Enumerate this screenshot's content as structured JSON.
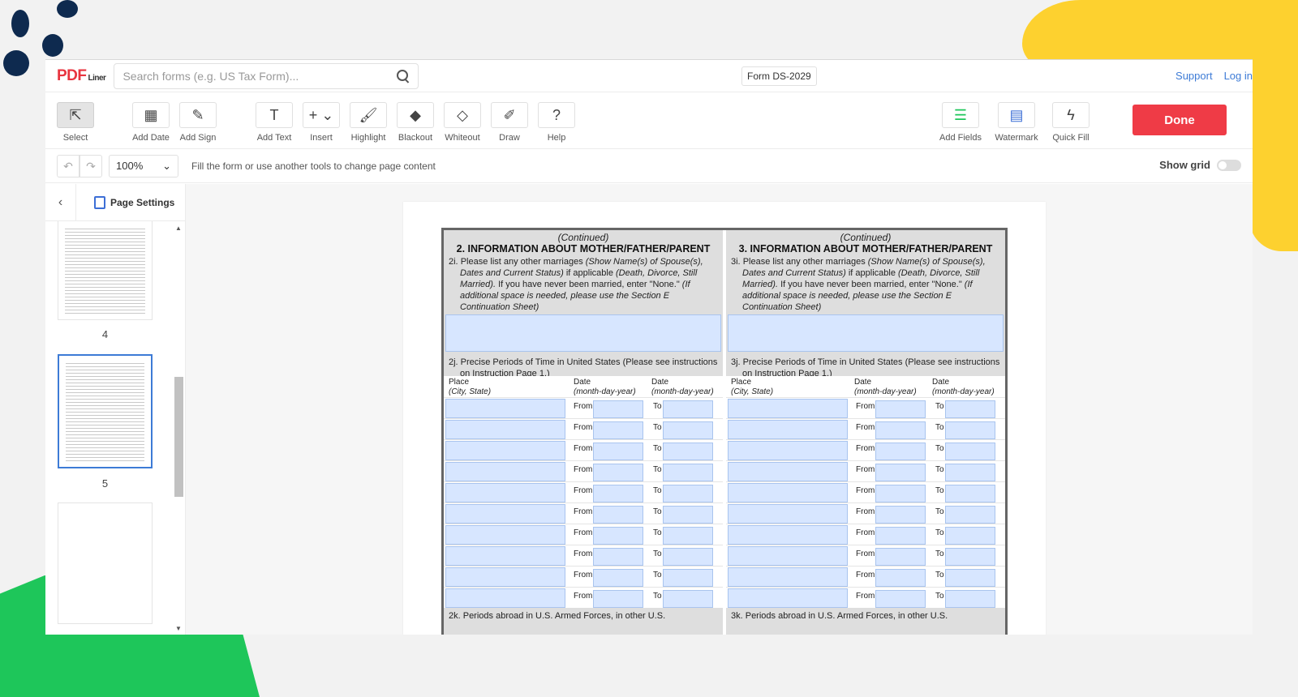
{
  "logo": {
    "main": "PDF",
    "sub": "Liner"
  },
  "search": {
    "placeholder": "Search forms (e.g. US Tax Form)..."
  },
  "form_name": "Form DS-2029",
  "top_links": {
    "support": "Support",
    "login": "Log in"
  },
  "toolbar": {
    "tools": [
      {
        "label": "Select",
        "icon": "⇱"
      },
      {
        "label": "Add Date",
        "icon": "▦"
      },
      {
        "label": "Add Sign",
        "icon": "✎"
      },
      {
        "label": "Add Text",
        "icon": "T"
      },
      {
        "label": "Insert",
        "icon": "+ ⌄"
      },
      {
        "label": "Highlight",
        "icon": "🖌"
      },
      {
        "label": "Blackout",
        "icon": "◆"
      },
      {
        "label": "Whiteout",
        "icon": "◇"
      },
      {
        "label": "Draw",
        "icon": "✐"
      },
      {
        "label": "Help",
        "icon": "?"
      },
      {
        "label": "Add Fields",
        "icon": "☰"
      },
      {
        "label": "Watermark",
        "icon": "▤"
      },
      {
        "label": "Quick Fill",
        "icon": "ϟ"
      }
    ],
    "done_label": "Done"
  },
  "subbar": {
    "undo": "↶",
    "redo": "↷",
    "zoom": "100%",
    "zoom_arrow": "⌄",
    "hint": "Fill the form or use another tools to change page content",
    "show_grid": "Show grid"
  },
  "sidebar": {
    "collapse": "‹",
    "page_settings": "Page Settings",
    "pages": [
      "4",
      "5"
    ],
    "scroll_up": "▲",
    "scroll_down": "▼"
  },
  "document": {
    "left": {
      "continued": "(Continued)",
      "heading": "2. INFORMATION ABOUT MOTHER/FATHER/PARENT",
      "q_i_num": "2i.",
      "q_j": "2j. Precise Periods of Time in United States (Please see instructions on Instruction Page 1.)",
      "q_k": "2k. Periods abroad in U.S. Armed Forces, in other U.S."
    },
    "right": {
      "continued": "(Continued)",
      "heading": "3. INFORMATION ABOUT MOTHER/FATHER/PARENT",
      "q_i_num": "3i.",
      "q_j": "3j. Precise Periods of Time in United States (Please see instructions on Instruction Page 1.)",
      "q_k": "3k. Periods abroad in U.S. Armed Forces, in other U.S."
    },
    "q_i_text_a": "Please list any other marriages ",
    "q_i_text_b": "(Show Name(s) of Spouse(s), Dates and Current Status)",
    "q_i_text_c": " if applicable ",
    "q_i_text_d": "(Death, Divorce, Still Married).",
    "q_i_text_e": " If you have never been married, enter \"None.\" ",
    "q_i_text_f": "(If additional space is needed, please use the Section E Continuation Sheet)",
    "col_place": "Place",
    "col_place_sub": "(City, State)",
    "col_date": "Date",
    "col_date_sub": "(month-day-year)",
    "from_label": "From",
    "to_label": "To"
  }
}
